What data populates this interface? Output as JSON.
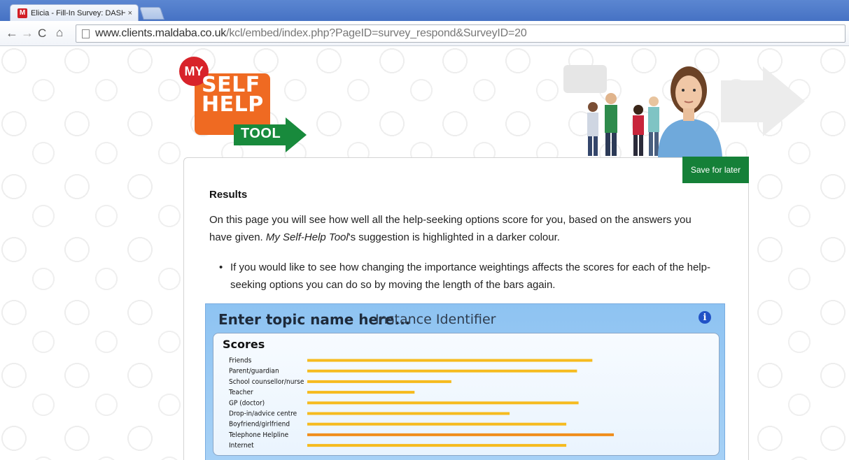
{
  "browser": {
    "tab_title": "Elicia - Fill-In Survey: DASH_",
    "tab_close": "×",
    "favicon_letter": "M",
    "url_host": "www.clients.maldaba.co.uk",
    "url_path": "/kcl/embed/index.php?PageID=survey_respond&SurveyID=20",
    "nav_back": "←",
    "nav_forward": "→",
    "nav_reload": "C",
    "nav_home": "⌂"
  },
  "logo": {
    "my": "MY",
    "self": "SELF",
    "help": "HELP",
    "tool": "TOOL"
  },
  "save_button": "Save for later",
  "results": {
    "title": "Results",
    "intro_part1": "On this page you will see how well all the help-seeking options score for you, based on the answers you have given. ",
    "intro_italic": "My Self-Help Tool",
    "intro_part2": "'s suggestion is highlighted in a darker colour.",
    "bullets": [
      "If you would like to see how changing the importance weightings affects the scores for each of the help-seeking options you can do so by moving the length of the bars again."
    ]
  },
  "widget": {
    "title": "Enter topic name here...",
    "identifier": "Instance Identifier",
    "info": "i",
    "scores_title": "Scores"
  },
  "colors": {
    "bar_normal": "#f6bb1f",
    "bar_highlight": "#f08e1c",
    "accent_green": "#158038",
    "logo_orange": "#ef6a22",
    "logo_red": "#d8232a"
  },
  "chart_data": {
    "type": "bar",
    "orientation": "horizontal",
    "categories": [
      "Friends",
      "Parent/guardian",
      "School counsellor/nurse",
      "Teacher",
      "GP (doctor)",
      "Drop-in/advice centre",
      "Boyfriend/girlfriend",
      "Telephone Helpline",
      "Internet"
    ],
    "values": [
      0.93,
      0.88,
      0.47,
      0.35,
      0.885,
      0.66,
      0.845,
      1.0,
      0.845
    ],
    "highlighted": "Telephone Helpline",
    "xlim": [
      0,
      1
    ]
  }
}
